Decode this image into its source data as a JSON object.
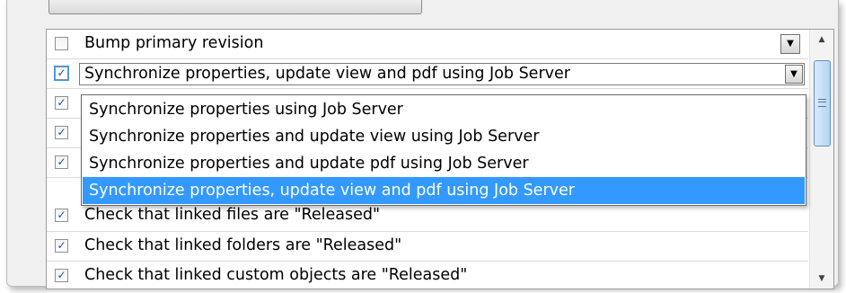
{
  "rows": [
    {
      "label": "Bump primary revision",
      "checked": false
    },
    {
      "label": "Synchronize properties, update view and pdf using Job Server",
      "checked": true,
      "combo": true
    },
    {
      "label": "",
      "checked": true
    },
    {
      "label": "",
      "checked": true
    },
    {
      "label": "",
      "checked": true
    },
    {
      "label": "Check that linked files are \"Released\"",
      "checked": true
    },
    {
      "label": "Check that linked folders are \"Released\"",
      "checked": true
    },
    {
      "label": "Check that linked custom objects are \"Released\"",
      "checked": true
    }
  ],
  "check_glyph": "✓",
  "dropdown_arrow_icon": "▼",
  "scroll_up_icon": "▲",
  "scroll_down_icon": "▼",
  "dropdown": {
    "options": [
      "Synchronize properties using Job Server",
      "Synchronize properties and update view using Job Server",
      "Synchronize properties and update pdf using Job Server",
      "Synchronize properties, update view and pdf using Job Server"
    ],
    "selected_index": 3
  },
  "colors": {
    "selection": "#3399ff",
    "check": "#1f4fa8",
    "scroll_thumb": "#b6d4f1"
  }
}
